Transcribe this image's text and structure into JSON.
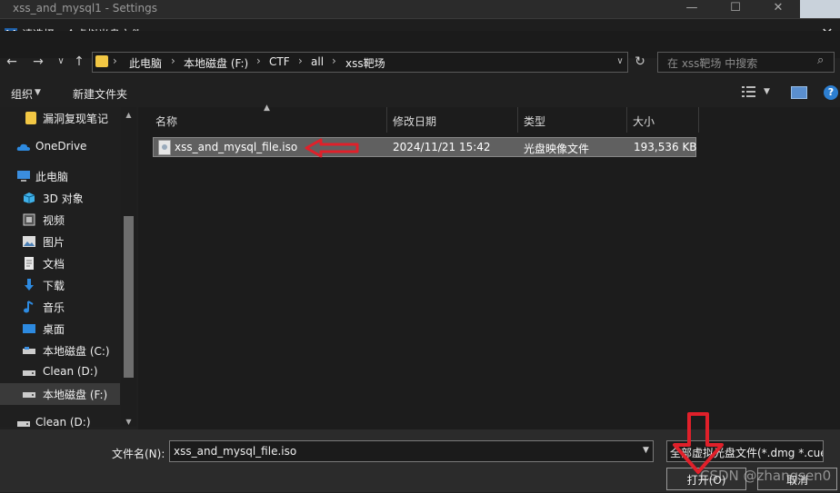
{
  "behind_window": {
    "title": "xss_and_mysql1 - Settings",
    "min": "—",
    "max": "☐",
    "close": "✕"
  },
  "dialog": {
    "title": "请选择一个虚拟光盘文件",
    "close": "✕"
  },
  "nav": {
    "back": "←",
    "forward": "→",
    "history": "∨",
    "up": "↑",
    "breadcrumbs": [
      "此电脑",
      "本地磁盘 (F:)",
      "CTF",
      "all",
      "xss靶场"
    ],
    "sep": "›",
    "dropdown": "∨",
    "refresh": "↻",
    "search_placeholder": "在 xss靶场 中搜索",
    "search_glyph": "⌕"
  },
  "toolbar": {
    "organize": "组织",
    "new_folder": "新建文件夹",
    "help": "?"
  },
  "sidebar": {
    "items": [
      {
        "label": "漏洞复现笔记",
        "icon": "folder-icon"
      },
      {
        "label": "OneDrive",
        "icon": "cloud-icon"
      },
      {
        "label": "此电脑",
        "icon": "computer-icon"
      },
      {
        "label": "3D 对象",
        "icon": "cube-icon"
      },
      {
        "label": "视频",
        "icon": "video-icon"
      },
      {
        "label": "图片",
        "icon": "picture-icon"
      },
      {
        "label": "文档",
        "icon": "document-icon"
      },
      {
        "label": "下载",
        "icon": "download-icon"
      },
      {
        "label": "音乐",
        "icon": "music-icon"
      },
      {
        "label": "桌面",
        "icon": "desktop-icon"
      },
      {
        "label": "本地磁盘 (C:)",
        "icon": "drive-icon"
      },
      {
        "label": "Clean (D:)",
        "icon": "drive-icon"
      },
      {
        "label": "本地磁盘 (F:)",
        "icon": "drive-icon",
        "selected": true
      },
      {
        "label": "Clean (D:)",
        "icon": "drive-icon"
      }
    ]
  },
  "filelist": {
    "columns": [
      "名称",
      "修改日期",
      "类型",
      "大小"
    ],
    "rows": [
      {
        "name": "xss_and_mysql_file.iso",
        "modified": "2024/11/21 15:42",
        "type": "光盘映像文件",
        "size": "193,536 KB",
        "selected": true
      }
    ]
  },
  "bottom": {
    "filename_label": "文件名(N):",
    "filename_value": "xss_and_mysql_file.iso",
    "filter_value": "全部虚拟光盘文件(*.dmg *.cue",
    "open_label": "打开(O)",
    "cancel_label": "取消",
    "watermark": "CSDN @zhangsen0"
  },
  "colors": {
    "annotation": "#e0202a",
    "accent": "#2d7fd1",
    "folder": "#f2c744"
  }
}
